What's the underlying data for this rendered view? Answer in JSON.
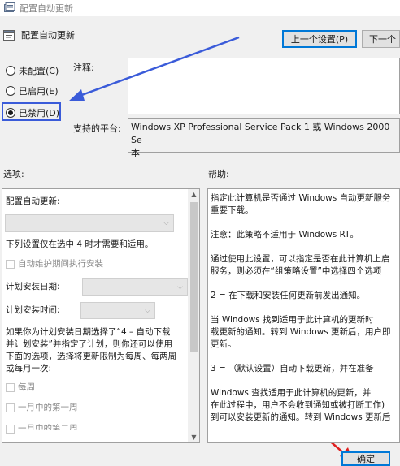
{
  "window": {
    "title": "配置自动更新"
  },
  "header": {
    "title": "配置自动更新"
  },
  "nav": {
    "prev_label": "上一个设置(P)",
    "next_label": "下一个"
  },
  "state": {
    "options": [
      {
        "label": "未配置(C)",
        "selected": false
      },
      {
        "label": "已启用(E)",
        "selected": false
      },
      {
        "label": "已禁用(D)",
        "selected": true
      }
    ]
  },
  "comment": {
    "label": "注释:",
    "value": ""
  },
  "platform": {
    "label": "支持的平台:",
    "value_line1": "Windows XP Professional Service Pack 1 或 Windows 2000 Se",
    "value_line2": "本"
  },
  "options_section": {
    "label": "选项:",
    "configure_label": "配置自动更新:",
    "note": "下列设置仅在选中 4 时才需要和适用。",
    "maintenance_checkbox": "自动维护期间执行安装",
    "install_day_label": "计划安装日期:",
    "install_time_label": "计划安装时间:",
    "paragraph": [
      "如果你为计划安装日期选择了“4 – 自动下载",
      "并计划安装”并指定了计划，则你还可以使用",
      "下面的选项，选择将更新限制为每周、每两周",
      "或每月一次:"
    ],
    "weekly": "每周",
    "first_week": "一月中的第一周",
    "second_week": "一月中的第二周"
  },
  "help_section": {
    "label": "帮助:",
    "lines": [
      "指定此计算机是否通过 Windows 自动更新服务",
      "重要下载。",
      "",
      "注意：此策略不适用于 Windows RT。",
      "",
      "通过使用此设置，可以指定是否在此计算机上启",
      "服务，则必须在“组策略设置”中选择四个选项",
      "",
      "        2 = 在下载和安装任何更新前发出通知。",
      "",
      "        当 Windows 找到适用于此计算机的更新时",
      "载更新的通知。转到 Windows 更新后，用户即",
      "更新。",
      "",
      "        3 = （默认设置）自动下载更新，并在准备",
      "",
      "        Windows 查找适用于此计算机的更新，并",
      "在此过程中，用户不会收到通知或被打断工作)",
      "到可以安装更新的通知。转到 Windows 更新后"
    ]
  },
  "footer": {
    "ok_label": "确定"
  },
  "colors": {
    "annotation_blue": "#3a5bd9",
    "annotation_red": "#e02020"
  }
}
